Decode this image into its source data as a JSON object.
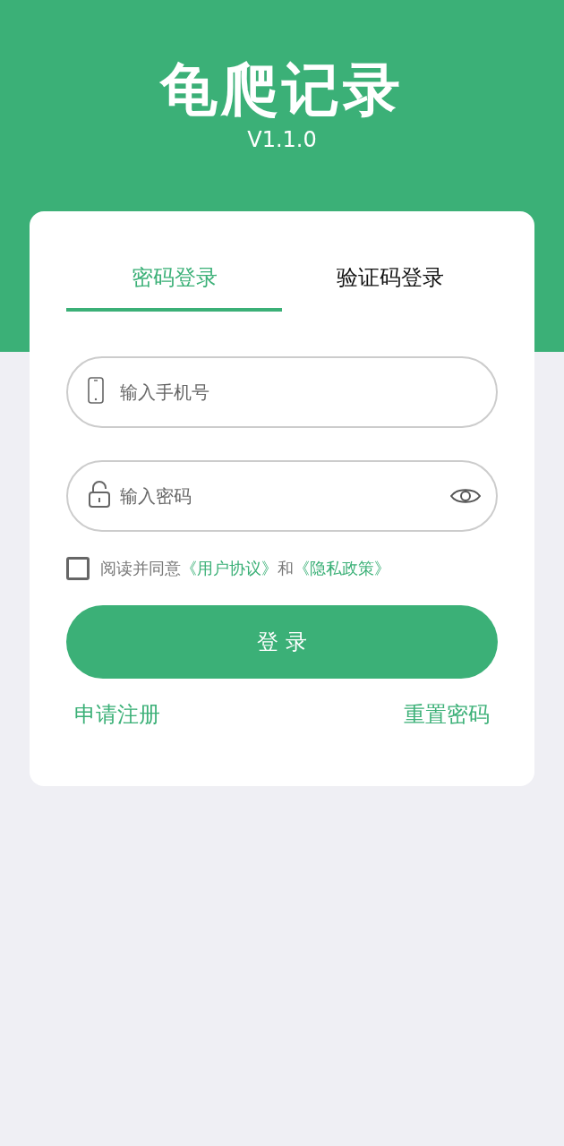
{
  "app": {
    "title": "龟爬记录",
    "version": "V1.1.0"
  },
  "tabs": [
    {
      "label": "密码登录",
      "selected": true
    },
    {
      "label": "验证码登录",
      "selected": false
    }
  ],
  "fields": [
    {
      "kind": "phone",
      "placeholder": "输入手机号"
    },
    {
      "kind": "password",
      "placeholder": "输入密码"
    }
  ],
  "agreement": {
    "checked": false,
    "text": "阅读并同意",
    "links": [
      "《用户协议》",
      "《隐私政策》"
    ],
    "joiner": "和"
  },
  "login_button": "登 录",
  "links": [
    "申请注册",
    "重置密码"
  ]
}
